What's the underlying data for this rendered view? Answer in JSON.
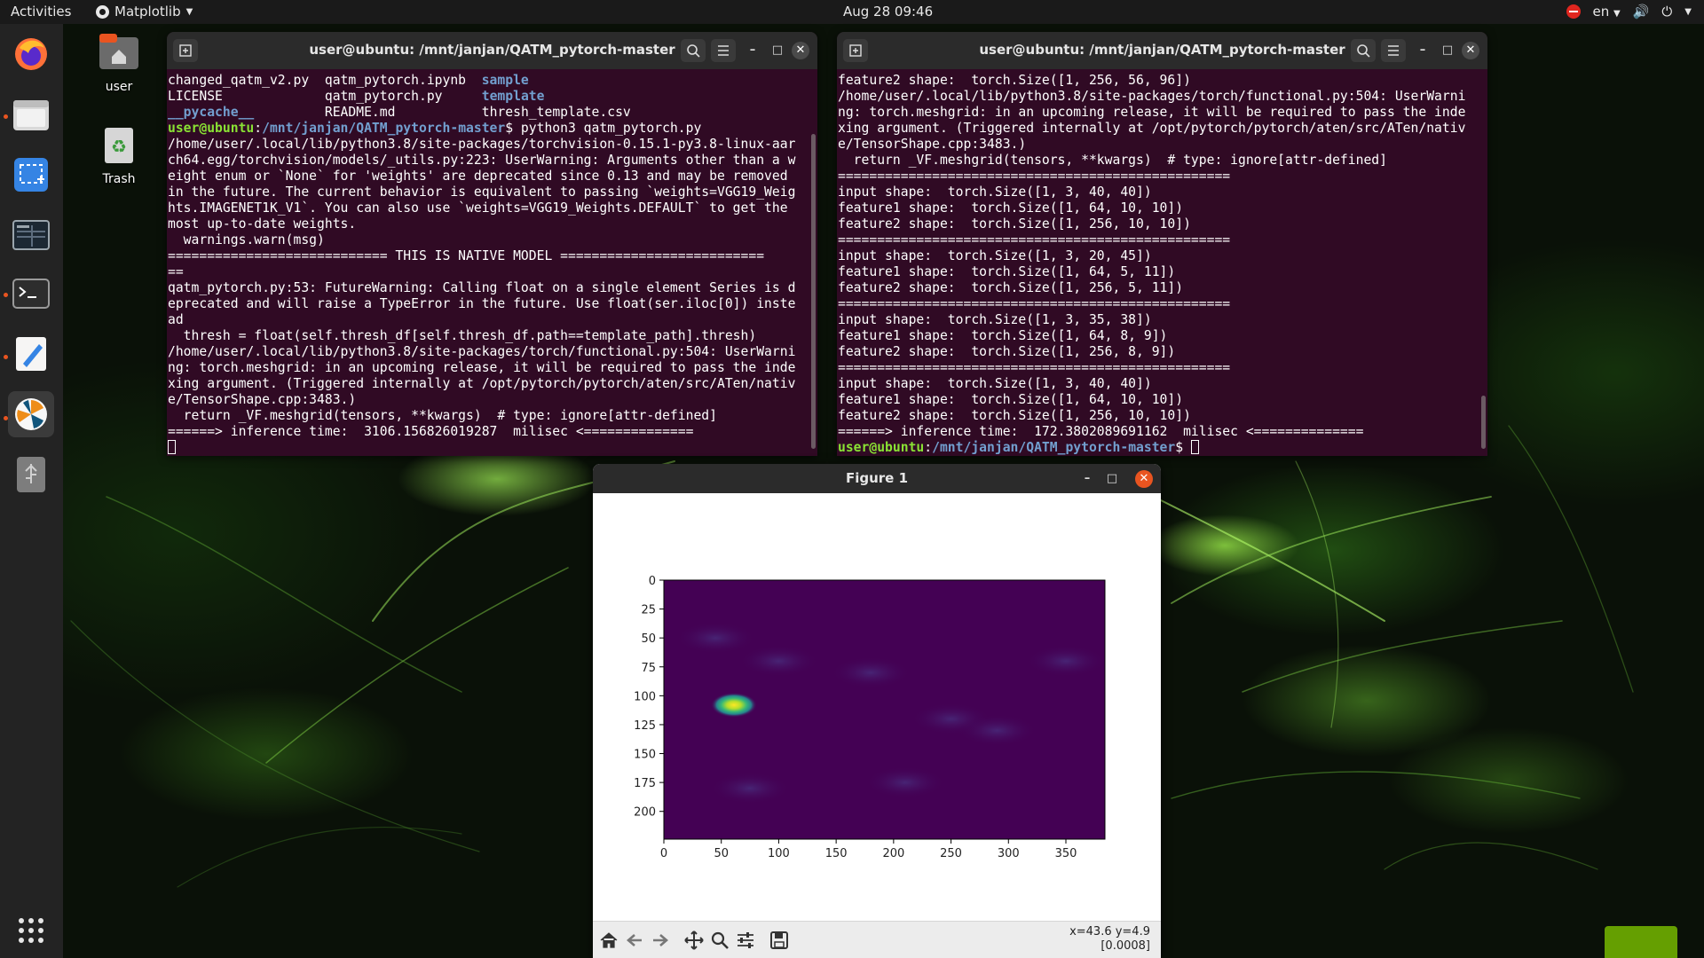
{
  "topbar": {
    "activities": "Activities",
    "app_name": "Matplotlib",
    "clock": "Aug 28  09:46",
    "language": "en"
  },
  "dock": {
    "items": [
      {
        "name": "firefox-icon"
      },
      {
        "name": "files-icon"
      },
      {
        "name": "screenshot-icon"
      },
      {
        "name": "system-monitor-icon"
      },
      {
        "name": "terminal-icon"
      },
      {
        "name": "text-editor-icon"
      },
      {
        "name": "matplotlib-icon"
      },
      {
        "name": "usb-drive-icon"
      }
    ],
    "show_apps_icon": "grid-icon"
  },
  "desktop": {
    "home_label": "user",
    "trash_label": "Trash"
  },
  "terminal_left": {
    "title": "user@ubuntu: /mnt/janjan/QATM_pytorch-master",
    "ls_rows": [
      [
        "changed_qatm_v2.py",
        "qatm_pytorch.ipynb",
        "sample"
      ],
      [
        "LICENSE",
        "qatm_pytorch.py",
        "template"
      ],
      [
        "__pycache__",
        "README.md",
        "thresh_template.csv"
      ]
    ],
    "prompt_user": "user@ubuntu",
    "prompt_path": "/mnt/janjan/QATM_pytorch-master",
    "command": " python3 qatm_pytorch.py",
    "output": [
      "/home/user/.local/lib/python3.8/site-packages/torchvision-0.15.1-py3.8-linux-aar",
      "ch64.egg/torchvision/models/_utils.py:223: UserWarning: Arguments other than a w",
      "eight enum or `None` for 'weights' are deprecated since 0.13 and may be removed",
      "in the future. The current behavior is equivalent to passing `weights=VGG19_Weig",
      "hts.IMAGENET1K_V1`. You can also use `weights=VGG19_Weights.DEFAULT` to get the",
      "most up-to-date weights.",
      "  warnings.warn(msg)",
      "============================ THIS IS NATIVE MODEL ==========================",
      "==",
      "qatm_pytorch.py:53: FutureWarning: Calling float on a single element Series is d",
      "eprecated and will raise a TypeError in the future. Use float(ser.iloc[0]) inste",
      "ad",
      "  thresh = float(self.thresh_df[self.thresh_df.path==template_path].thresh)",
      "/home/user/.local/lib/python3.8/site-packages/torch/functional.py:504: UserWarni",
      "ng: torch.meshgrid: in an upcoming release, it will be required to pass the inde",
      "xing argument. (Triggered internally at /opt/pytorch/pytorch/aten/src/ATen/nativ",
      "e/TensorShape.cpp:3483.)",
      "  return _VF.meshgrid(tensors, **kwargs)  # type: ignore[attr-defined]",
      "======> inference time:  3106.156826019287  milisec <=============="
    ]
  },
  "terminal_right": {
    "title": "user@ubuntu: /mnt/janjan/QATM_pytorch-master",
    "output": [
      "feature2 shape:  torch.Size([1, 256, 56, 96])",
      "/home/user/.local/lib/python3.8/site-packages/torch/functional.py:504: UserWarni",
      "ng: torch.meshgrid: in an upcoming release, it will be required to pass the inde",
      "xing argument. (Triggered internally at /opt/pytorch/pytorch/aten/src/ATen/nativ",
      "e/TensorShape.cpp:3483.)",
      "  return _VF.meshgrid(tensors, **kwargs)  # type: ignore[attr-defined]",
      "==================================================",
      "input shape:  torch.Size([1, 3, 40, 40])",
      "feature1 shape:  torch.Size([1, 64, 10, 10])",
      "feature2 shape:  torch.Size([1, 256, 10, 10])",
      "==================================================",
      "input shape:  torch.Size([1, 3, 20, 45])",
      "feature1 shape:  torch.Size([1, 64, 5, 11])",
      "feature2 shape:  torch.Size([1, 256, 5, 11])",
      "==================================================",
      "input shape:  torch.Size([1, 3, 35, 38])",
      "feature1 shape:  torch.Size([1, 64, 8, 9])",
      "feature2 shape:  torch.Size([1, 256, 8, 9])",
      "==================================================",
      "input shape:  torch.Size([1, 3, 40, 40])",
      "feature1 shape:  torch.Size([1, 64, 10, 10])",
      "feature2 shape:  torch.Size([1, 256, 10, 10])",
      "======> inference time:  172.3802089691162  milisec <=============="
    ],
    "prompt_user": "user@ubuntu",
    "prompt_path": "/mnt/janjan/QATM_pytorch-master"
  },
  "figure": {
    "title": "Figure 1",
    "coords_line1": "x=43.6 y=4.9",
    "coords_line2": "[0.0008]",
    "toolbar": [
      "home-icon",
      "back-icon",
      "forward-icon",
      "pan-icon",
      "zoom-icon",
      "configure-subplots-icon",
      "save-icon"
    ]
  },
  "chart_data": {
    "type": "heatmap",
    "title": "",
    "xlabel": "",
    "ylabel": "",
    "xlim": [
      0,
      384
    ],
    "ylim": [
      224,
      0
    ],
    "x_ticks": [
      0,
      50,
      100,
      150,
      200,
      250,
      300,
      350
    ],
    "y_ticks": [
      0,
      25,
      50,
      75,
      100,
      125,
      150,
      175,
      200
    ],
    "colormap": "viridis",
    "background_color": "#440154",
    "hotspot": {
      "x": 61,
      "y": 108,
      "color": "#fde725"
    },
    "faint_regions": [
      {
        "x": 45,
        "y": 50
      },
      {
        "x": 100,
        "y": 70
      },
      {
        "x": 180,
        "y": 80
      },
      {
        "x": 250,
        "y": 120
      },
      {
        "x": 290,
        "y": 130
      },
      {
        "x": 75,
        "y": 180
      },
      {
        "x": 210,
        "y": 175
      },
      {
        "x": 350,
        "y": 70
      }
    ]
  }
}
